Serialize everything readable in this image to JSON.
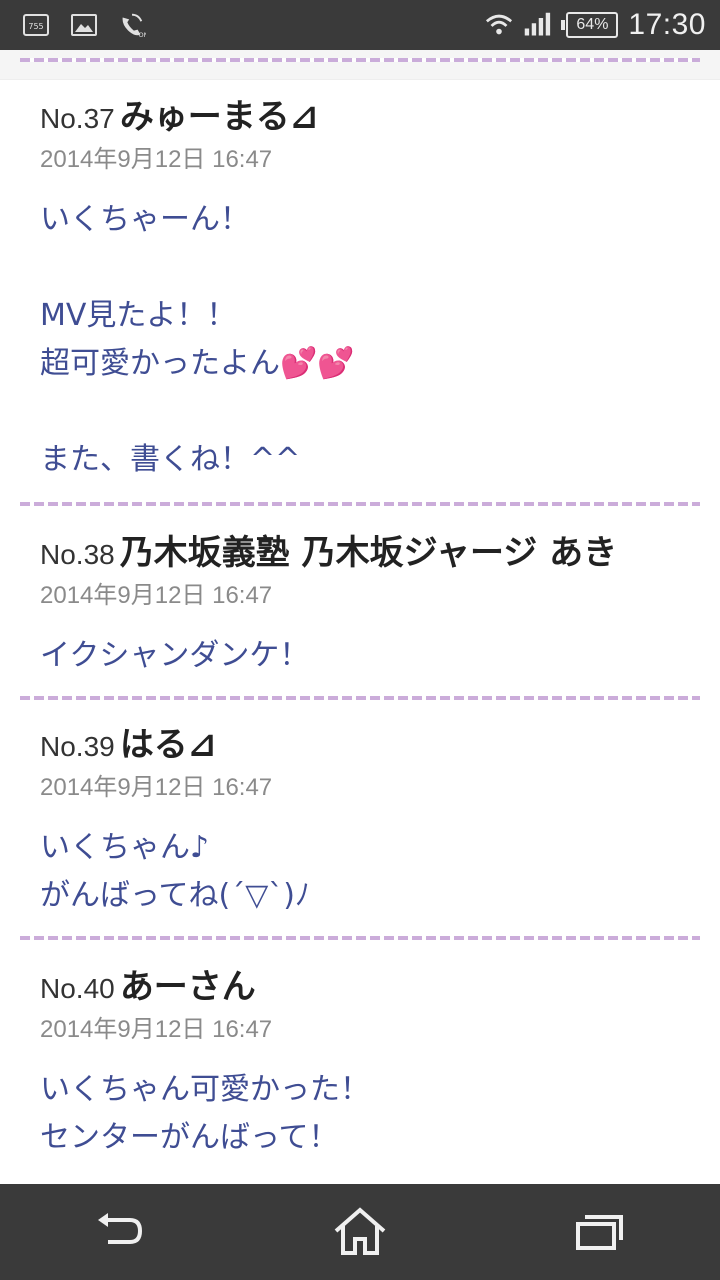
{
  "status_bar": {
    "time": "17:30",
    "battery": "64%",
    "icons": [
      "app-notification-icon",
      "image-icon",
      "call-icon",
      "wifi-icon",
      "signal-icon",
      "battery-icon"
    ]
  },
  "posts": [
    {
      "no": "No.37",
      "author": "みゅーまる⊿",
      "date": "2014年9月12日 16:47",
      "lines": [
        "いくちゃーん！",
        "",
        "MV見たよ！！",
        "超可愛かったよん💕💕",
        "",
        "また、書くね！^^"
      ]
    },
    {
      "no": "No.38",
      "author": "乃木坂義塾 乃木坂ジャージ あき",
      "date": "2014年9月12日 16:47",
      "lines": [
        "イクシャンダンケ！"
      ]
    },
    {
      "no": "No.39",
      "author": "はる⊿",
      "date": "2014年9月12日 16:47",
      "lines": [
        "いくちゃん♪",
        "がんばってね(´▽`)ﾉ"
      ]
    },
    {
      "no": "No.40",
      "author": "あーさん",
      "date": "2014年9月12日 16:47",
      "lines": [
        "いくちゃん可愛かった！",
        "センターがんばって！"
      ]
    }
  ],
  "nav": {
    "icons": [
      "back-icon",
      "home-icon",
      "recent-apps-icon"
    ]
  },
  "colors": {
    "status_bar_bg": "#3a3a3a",
    "body_text": "#3f4d93",
    "divider": "#c8a8d8"
  }
}
